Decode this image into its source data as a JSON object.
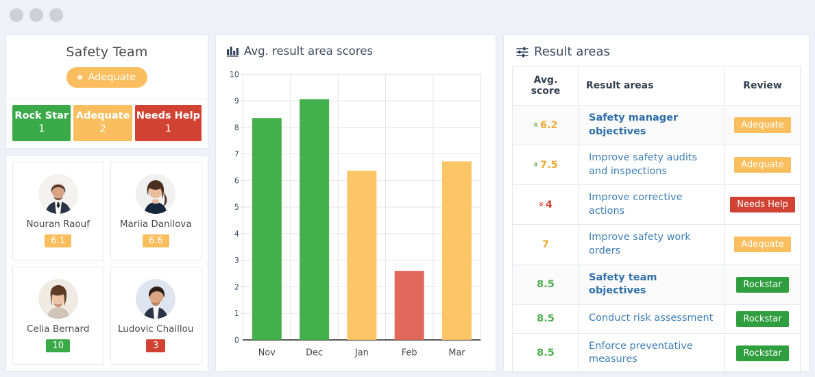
{
  "window": {
    "dots": [
      "minimize-dot",
      "maximize-dot",
      "close-dot"
    ]
  },
  "team_panel": {
    "title": "Safety Team",
    "status_pill": {
      "label": "Adequate",
      "icon": "star-icon",
      "color": "#fbbe5e"
    },
    "tiles": [
      {
        "label": "Rock Star",
        "count": "1",
        "color": "#3aa948"
      },
      {
        "label": "Adequate",
        "count": "2",
        "color": "#fbbe5e"
      },
      {
        "label": "Needs Help",
        "count": "1",
        "color": "#d14233"
      }
    ],
    "people": [
      {
        "name": "Nouran Raouf",
        "score": "6.1",
        "score_color": "#fbbe5e",
        "avatar": "man-suit-avatar"
      },
      {
        "name": "Mariia Danilova",
        "score": "6.6",
        "score_color": "#fbbe5e",
        "avatar": "woman-long-hair-avatar"
      },
      {
        "name": "Celia Bernard",
        "score": "10",
        "score_color": "#3aa948",
        "avatar": "woman-smiling-avatar"
      },
      {
        "name": "Ludovic Chaillou",
        "score": "3",
        "score_color": "#d14233",
        "avatar": "man-beard-avatar"
      }
    ]
  },
  "chart_panel": {
    "icon": "bar-chart-icon",
    "title": "Avg. result area scores"
  },
  "chart_data": {
    "type": "bar",
    "title": "Avg. result area scores",
    "xlabel": "",
    "ylabel": "",
    "categories": [
      "Nov",
      "Dec",
      "Jan",
      "Feb",
      "Mar"
    ],
    "values": [
      8.35,
      9.06,
      6.37,
      2.6,
      6.72
    ],
    "bar_colors": [
      "#44b04c",
      "#44b04c",
      "#fcc565",
      "#e0695c",
      "#fcc565"
    ],
    "ylim": [
      0,
      10
    ],
    "yticks": [
      0,
      1,
      2,
      3,
      4,
      5,
      6,
      7,
      8,
      9,
      10
    ],
    "ytick_labels": [
      "0",
      "1",
      "2",
      "3",
      "4",
      "5",
      "6",
      "7",
      "8",
      "9",
      "10"
    ],
    "grid": true,
    "legend": false
  },
  "result_areas": {
    "icon": "sliders-icon",
    "title": "Result areas",
    "columns": [
      "Avg. score",
      "Result areas",
      "Review"
    ],
    "rows": [
      {
        "score": "6.2",
        "trend": "up",
        "score_color": "orange",
        "area": "Safety manager objectives",
        "bold": true,
        "review": "Adequate",
        "review_style": "rev-adequate"
      },
      {
        "score": "7.5",
        "trend": "up",
        "score_color": "orange",
        "area": "Improve safety audits and inspections",
        "bold": false,
        "review": "Adequate",
        "review_style": "rev-adequate"
      },
      {
        "score": "4",
        "trend": "down",
        "score_color": "red",
        "area": "Improve corrective actions",
        "bold": false,
        "review": "Needs Help",
        "review_style": "rev-needs"
      },
      {
        "score": "7",
        "trend": "none",
        "score_color": "orange",
        "area": "Improve safety work orders",
        "bold": false,
        "review": "Adequate",
        "review_style": "rev-adequate"
      },
      {
        "score": "8.5",
        "trend": "none",
        "score_color": "green",
        "area": "Safety team objectives",
        "bold": true,
        "review": "Rockstar",
        "review_style": "rev-rock"
      },
      {
        "score": "8.5",
        "trend": "none",
        "score_color": "green",
        "area": "Conduct risk assessment",
        "bold": false,
        "review": "Rockstar",
        "review_style": "rev-rock"
      },
      {
        "score": "8.5",
        "trend": "none",
        "score_color": "green",
        "area": "Enforce preventative measures",
        "bold": false,
        "review": "Rockstar",
        "review_style": "rev-rock"
      }
    ]
  }
}
